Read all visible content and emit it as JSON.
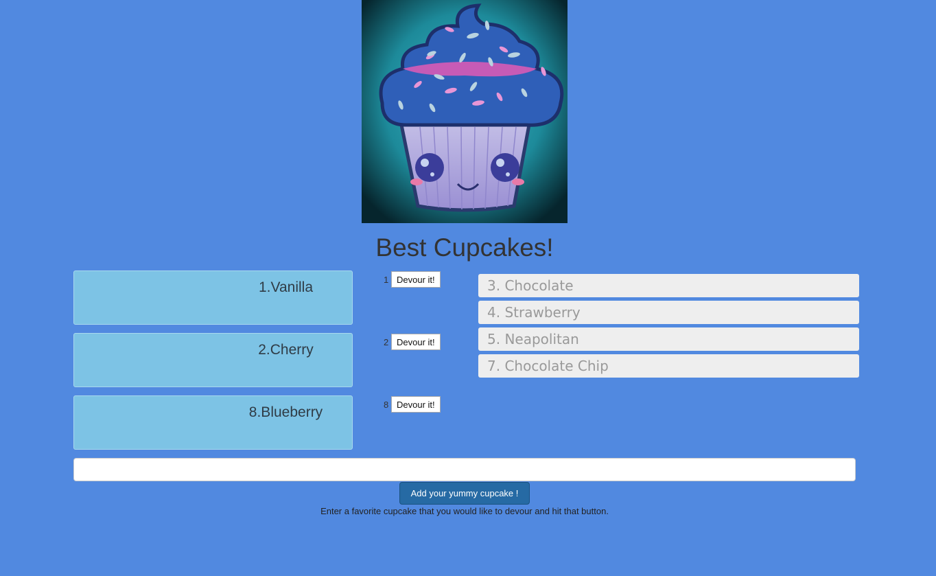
{
  "hero": {
    "image_name": "cupcake-illustration"
  },
  "title": "Best Cupcakes!",
  "cupcakes": [
    {
      "id": "1",
      "label": "1.Vanilla",
      "button": "Devour it!"
    },
    {
      "id": "2",
      "label": "2.Cherry",
      "button": "Devour it!"
    },
    {
      "id": "8",
      "label": "8.Blueberry",
      "button": "Devour it!"
    }
  ],
  "devoured": [
    "3. Chocolate",
    "4. Strawberry",
    "5. Neapolitan",
    "7. Chocolate Chip"
  ],
  "form": {
    "input_value": "",
    "submit_label": "Add your yummy cupcake !",
    "help": "Enter a favorite cupcake that you would like to devour and hit that button."
  },
  "colors": {
    "background": "#5189e0",
    "card": "#7dc3e5",
    "devoured": "#eeeeee",
    "submit": "#266aa4"
  }
}
